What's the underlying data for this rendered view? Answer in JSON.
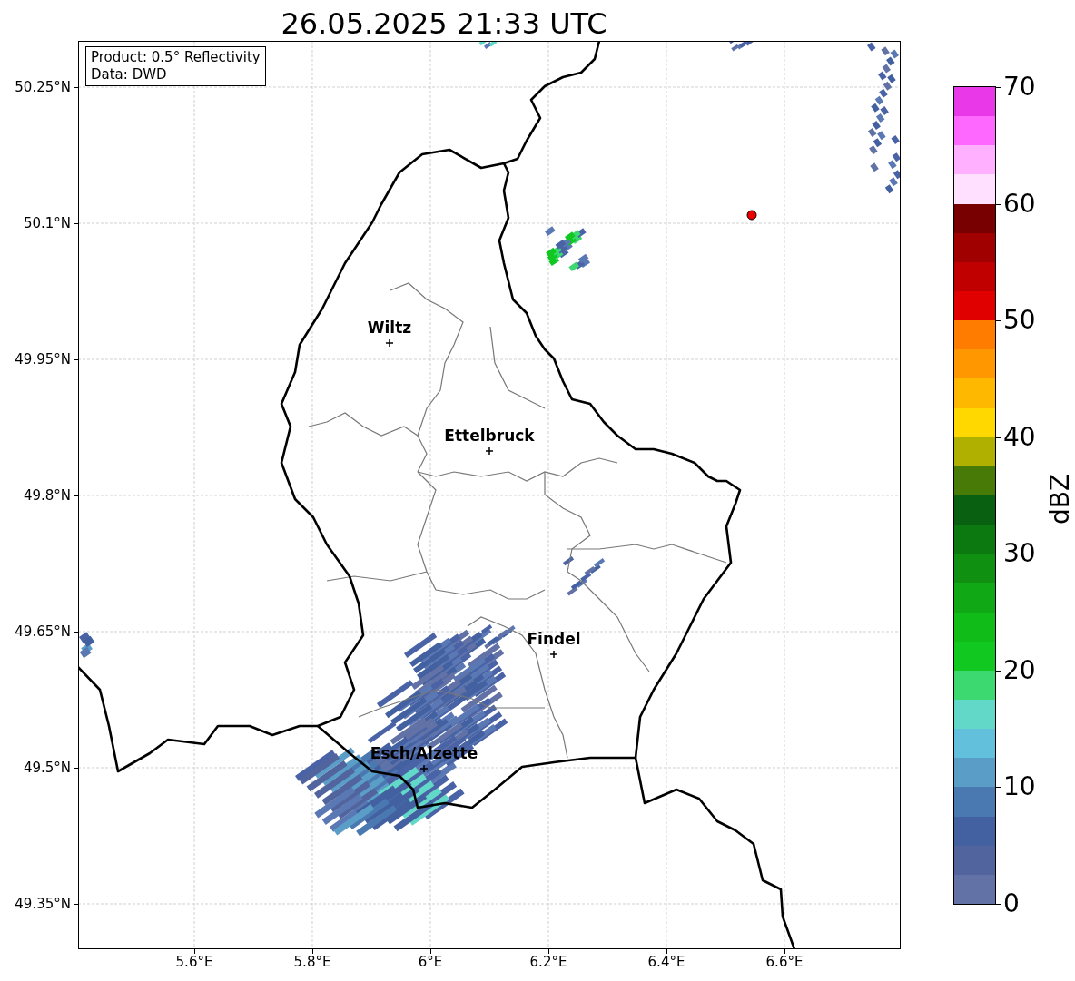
{
  "title": "26.05.2025 21:33 UTC",
  "info_box": [
    "Product: 0.5° Reflectivity",
    "Data: DWD"
  ],
  "lat_ticks": [
    "50.25°N",
    "50.1°N",
    "49.95°N",
    "49.8°N",
    "49.65°N",
    "49.5°N",
    "49.35°N"
  ],
  "lon_ticks": [
    "5.6°E",
    "5.8°E",
    "6°E",
    "6.2°E",
    "6.4°E",
    "6.6°E"
  ],
  "cities": [
    {
      "name": "Wiltz"
    },
    {
      "name": "Ettelbruck"
    },
    {
      "name": "Findel"
    },
    {
      "name": "Esch/Alzette"
    }
  ],
  "colorbar": {
    "label": "dBZ",
    "ticks": [
      "70",
      "60",
      "50",
      "40",
      "30",
      "20",
      "10",
      "0"
    ],
    "bins": [
      {
        "color": "#6272a6"
      },
      {
        "color": "#52649e"
      },
      {
        "color": "#4361a0"
      },
      {
        "color": "#4a78b0"
      },
      {
        "color": "#5a9ec8"
      },
      {
        "color": "#62c0dc"
      },
      {
        "color": "#62d8c8"
      },
      {
        "color": "#3cd870"
      },
      {
        "color": "#10c820"
      },
      {
        "color": "#10bc18"
      },
      {
        "color": "#10a814"
      },
      {
        "color": "#109010"
      },
      {
        "color": "#0c7810"
      },
      {
        "color": "#086010"
      },
      {
        "color": "#487a08"
      },
      {
        "color": "#b0b000"
      },
      {
        "color": "#ffd800"
      },
      {
        "color": "#ffb800"
      },
      {
        "color": "#ff9800"
      },
      {
        "color": "#ff7c00"
      },
      {
        "color": "#e00000"
      },
      {
        "color": "#c00000"
      },
      {
        "color": "#a00000"
      },
      {
        "color": "#780000"
      },
      {
        "color": "#ffe0ff"
      },
      {
        "color": "#ffb0ff"
      },
      {
        "color": "#ff68ff"
      },
      {
        "color": "#e838e8"
      }
    ]
  }
}
